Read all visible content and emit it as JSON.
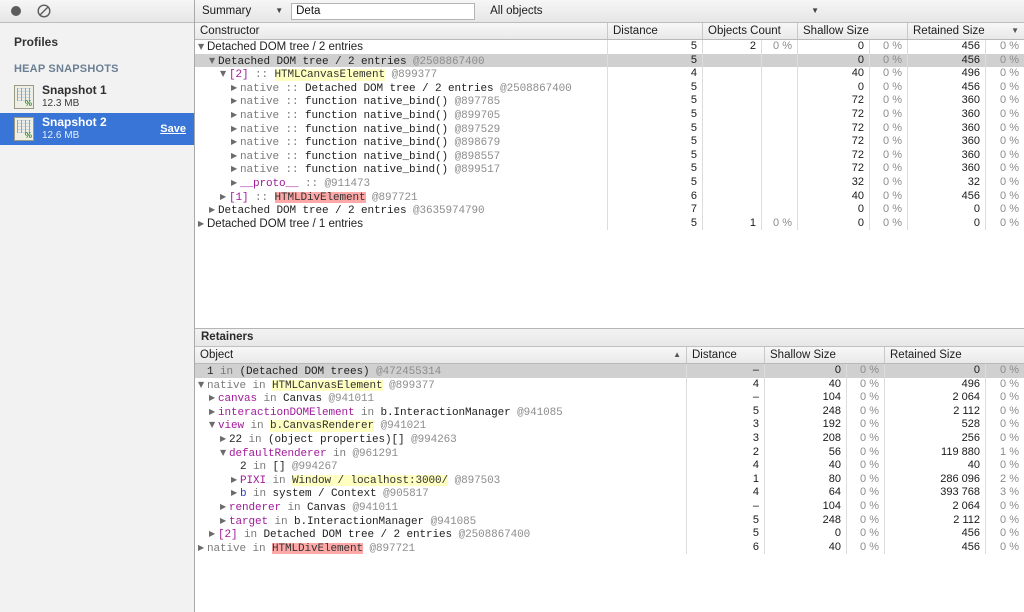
{
  "toolbar": {
    "record_icon": "record-circle-icon",
    "clear_icon": "clear-ban-icon"
  },
  "sidebar": {
    "title": "Profiles",
    "section_label": "HEAP SNAPSHOTS",
    "snapshots": [
      {
        "name": "Snapshot 1",
        "size": "12.3 MB",
        "selected": false,
        "save_label": ""
      },
      {
        "name": "Snapshot 2",
        "size": "12.6 MB",
        "selected": true,
        "save_label": "Save"
      }
    ]
  },
  "main_toolbar": {
    "view_mode": "Summary",
    "search_value": "Deta",
    "filter": "All objects"
  },
  "constructors_grid": {
    "columns": [
      "Constructor",
      "Distance",
      "Objects Count",
      "Shallow Size",
      "Retained Size"
    ],
    "sorted_column": "Retained Size",
    "sort_dir": "desc",
    "rows": [
      {
        "indent": 0,
        "tri": "open",
        "mono": false,
        "parts": [
          {
            "t": "Detached DOM tree / 2 entries",
            "c": "k-plain"
          }
        ],
        "distance": "5",
        "count": "2",
        "count_pct": "0 %",
        "shallow": "0",
        "shallow_pct": "0 %",
        "retained": "456",
        "retained_pct": "0 %",
        "selected": false
      },
      {
        "indent": 1,
        "tri": "open",
        "mono": true,
        "parts": [
          {
            "t": "Detached DOM tree / 2 entries ",
            "c": "k-plain"
          },
          {
            "t": "@2508867400",
            "c": "k-id"
          }
        ],
        "distance": "5",
        "count": "",
        "count_pct": "",
        "shallow": "0",
        "shallow_pct": "0 %",
        "retained": "456",
        "retained_pct": "0 %",
        "selected": true
      },
      {
        "indent": 2,
        "tri": "open",
        "mono": true,
        "parts": [
          {
            "t": "[2]",
            "c": "k-prop"
          },
          {
            "t": " :: ",
            "c": "k-gray"
          },
          {
            "t": "HTMLCanvasElement",
            "c": "hl-y"
          },
          {
            "t": " @899377",
            "c": "k-id"
          }
        ],
        "distance": "4",
        "count": "",
        "count_pct": "",
        "shallow": "40",
        "shallow_pct": "0 %",
        "retained": "496",
        "retained_pct": "0 %",
        "selected": false
      },
      {
        "indent": 3,
        "tri": "closed",
        "mono": true,
        "parts": [
          {
            "t": "native",
            "c": "k-gray"
          },
          {
            "t": " :: ",
            "c": "k-gray"
          },
          {
            "t": "Detached DOM tree / 2 entries ",
            "c": "k-plain"
          },
          {
            "t": "@2508867400",
            "c": "k-id"
          }
        ],
        "distance": "5",
        "count": "",
        "count_pct": "",
        "shallow": "0",
        "shallow_pct": "0 %",
        "retained": "456",
        "retained_pct": "0 %",
        "selected": false
      },
      {
        "indent": 3,
        "tri": "closed",
        "mono": true,
        "parts": [
          {
            "t": "native",
            "c": "k-gray"
          },
          {
            "t": " :: ",
            "c": "k-gray"
          },
          {
            "t": "function native_bind() ",
            "c": "k-plain"
          },
          {
            "t": "@897785",
            "c": "k-id"
          }
        ],
        "distance": "5",
        "count": "",
        "count_pct": "",
        "shallow": "72",
        "shallow_pct": "0 %",
        "retained": "360",
        "retained_pct": "0 %",
        "selected": false
      },
      {
        "indent": 3,
        "tri": "closed",
        "mono": true,
        "parts": [
          {
            "t": "native",
            "c": "k-gray"
          },
          {
            "t": " :: ",
            "c": "k-gray"
          },
          {
            "t": "function native_bind() ",
            "c": "k-plain"
          },
          {
            "t": "@899705",
            "c": "k-id"
          }
        ],
        "distance": "5",
        "count": "",
        "count_pct": "",
        "shallow": "72",
        "shallow_pct": "0 %",
        "retained": "360",
        "retained_pct": "0 %",
        "selected": false
      },
      {
        "indent": 3,
        "tri": "closed",
        "mono": true,
        "parts": [
          {
            "t": "native",
            "c": "k-gray"
          },
          {
            "t": " :: ",
            "c": "k-gray"
          },
          {
            "t": "function native_bind() ",
            "c": "k-plain"
          },
          {
            "t": "@897529",
            "c": "k-id"
          }
        ],
        "distance": "5",
        "count": "",
        "count_pct": "",
        "shallow": "72",
        "shallow_pct": "0 %",
        "retained": "360",
        "retained_pct": "0 %",
        "selected": false
      },
      {
        "indent": 3,
        "tri": "closed",
        "mono": true,
        "parts": [
          {
            "t": "native",
            "c": "k-gray"
          },
          {
            "t": " :: ",
            "c": "k-gray"
          },
          {
            "t": "function native_bind() ",
            "c": "k-plain"
          },
          {
            "t": "@898679",
            "c": "k-id"
          }
        ],
        "distance": "5",
        "count": "",
        "count_pct": "",
        "shallow": "72",
        "shallow_pct": "0 %",
        "retained": "360",
        "retained_pct": "0 %",
        "selected": false
      },
      {
        "indent": 3,
        "tri": "closed",
        "mono": true,
        "parts": [
          {
            "t": "native",
            "c": "k-gray"
          },
          {
            "t": " :: ",
            "c": "k-gray"
          },
          {
            "t": "function native_bind() ",
            "c": "k-plain"
          },
          {
            "t": "@898557",
            "c": "k-id"
          }
        ],
        "distance": "5",
        "count": "",
        "count_pct": "",
        "shallow": "72",
        "shallow_pct": "0 %",
        "retained": "360",
        "retained_pct": "0 %",
        "selected": false
      },
      {
        "indent": 3,
        "tri": "closed",
        "mono": true,
        "parts": [
          {
            "t": "native",
            "c": "k-gray"
          },
          {
            "t": " :: ",
            "c": "k-gray"
          },
          {
            "t": "function native_bind() ",
            "c": "k-plain"
          },
          {
            "t": "@899517",
            "c": "k-id"
          }
        ],
        "distance": "5",
        "count": "",
        "count_pct": "",
        "shallow": "72",
        "shallow_pct": "0 %",
        "retained": "360",
        "retained_pct": "0 %",
        "selected": false
      },
      {
        "indent": 3,
        "tri": "closed",
        "mono": true,
        "parts": [
          {
            "t": "__proto__",
            "c": "k-prop"
          },
          {
            "t": " :: ",
            "c": "k-gray"
          },
          {
            "t": "@911473",
            "c": "k-id"
          }
        ],
        "distance": "5",
        "count": "",
        "count_pct": "",
        "shallow": "32",
        "shallow_pct": "0 %",
        "retained": "32",
        "retained_pct": "0 %",
        "selected": false
      },
      {
        "indent": 2,
        "tri": "closed",
        "mono": true,
        "parts": [
          {
            "t": "[1]",
            "c": "k-prop"
          },
          {
            "t": " :: ",
            "c": "k-gray"
          },
          {
            "t": "HTMLDivElement",
            "c": "hl-r"
          },
          {
            "t": " @897721",
            "c": "k-id"
          }
        ],
        "distance": "6",
        "count": "",
        "count_pct": "",
        "shallow": "40",
        "shallow_pct": "0 %",
        "retained": "456",
        "retained_pct": "0 %",
        "selected": false
      },
      {
        "indent": 1,
        "tri": "closed",
        "mono": true,
        "parts": [
          {
            "t": "Detached DOM tree / 2 entries ",
            "c": "k-plain"
          },
          {
            "t": "@3635974790",
            "c": "k-id"
          }
        ],
        "distance": "7",
        "count": "",
        "count_pct": "",
        "shallow": "0",
        "shallow_pct": "0 %",
        "retained": "0",
        "retained_pct": "0 %",
        "selected": false
      },
      {
        "indent": 0,
        "tri": "closed",
        "mono": false,
        "parts": [
          {
            "t": "Detached DOM tree / 1 entries",
            "c": "k-plain"
          }
        ],
        "distance": "5",
        "count": "1",
        "count_pct": "0 %",
        "shallow": "0",
        "shallow_pct": "0 %",
        "retained": "0",
        "retained_pct": "0 %",
        "selected": false
      }
    ]
  },
  "retainers": {
    "panel_title": "Retainers",
    "columns": [
      "Object",
      "Distance",
      "Shallow Size",
      "Retained Size"
    ],
    "sorted_column": "Object",
    "sort_dir": "asc",
    "rows": [
      {
        "indent": 0,
        "tri": "none",
        "mono": true,
        "parts": [
          {
            "t": "1",
            "c": "k-plain"
          },
          {
            "t": " in ",
            "c": "k-gray"
          },
          {
            "t": "(Detached DOM trees) ",
            "c": "k-plain"
          },
          {
            "t": "@472455314",
            "c": "k-id"
          }
        ],
        "distance": "–",
        "shallow": "0",
        "shallow_pct": "0 %",
        "retained": "0",
        "retained_pct": "0 %",
        "selected": true
      },
      {
        "indent": 0,
        "tri": "open",
        "mono": true,
        "parts": [
          {
            "t": "native",
            "c": "k-gray"
          },
          {
            "t": " in ",
            "c": "k-gray"
          },
          {
            "t": "HTMLCanvasElement",
            "c": "hl-y"
          },
          {
            "t": " @899377",
            "c": "k-id"
          }
        ],
        "distance": "4",
        "shallow": "40",
        "shallow_pct": "0 %",
        "retained": "496",
        "retained_pct": "0 %",
        "selected": false
      },
      {
        "indent": 1,
        "tri": "closed",
        "mono": true,
        "parts": [
          {
            "t": "canvas",
            "c": "k-prop"
          },
          {
            "t": " in ",
            "c": "k-gray"
          },
          {
            "t": "Canvas ",
            "c": "k-plain"
          },
          {
            "t": "@941011",
            "c": "k-id"
          }
        ],
        "distance": "–",
        "shallow": "104",
        "shallow_pct": "0 %",
        "retained": "2 064",
        "retained_pct": "0 %",
        "selected": false
      },
      {
        "indent": 1,
        "tri": "closed",
        "mono": true,
        "parts": [
          {
            "t": "interactionDOMElement",
            "c": "k-prop"
          },
          {
            "t": " in ",
            "c": "k-gray"
          },
          {
            "t": "b.InteractionManager ",
            "c": "k-plain"
          },
          {
            "t": "@941085",
            "c": "k-id"
          }
        ],
        "distance": "5",
        "shallow": "248",
        "shallow_pct": "0 %",
        "retained": "2 112",
        "retained_pct": "0 %",
        "selected": false
      },
      {
        "indent": 1,
        "tri": "open",
        "mono": true,
        "parts": [
          {
            "t": "view",
            "c": "k-prop"
          },
          {
            "t": " in ",
            "c": "k-gray"
          },
          {
            "t": "b.CanvasRenderer",
            "c": "hl-y"
          },
          {
            "t": " @941021",
            "c": "k-id"
          }
        ],
        "distance": "3",
        "shallow": "192",
        "shallow_pct": "0 %",
        "retained": "528",
        "retained_pct": "0 %",
        "selected": false
      },
      {
        "indent": 2,
        "tri": "closed",
        "mono": true,
        "parts": [
          {
            "t": "22",
            "c": "k-plain"
          },
          {
            "t": " in ",
            "c": "k-gray"
          },
          {
            "t": "(object properties)[] ",
            "c": "k-plain"
          },
          {
            "t": "@994263",
            "c": "k-id"
          }
        ],
        "distance": "3",
        "shallow": "208",
        "shallow_pct": "0 %",
        "retained": "256",
        "retained_pct": "0 %",
        "selected": false
      },
      {
        "indent": 2,
        "tri": "open",
        "mono": true,
        "parts": [
          {
            "t": "defaultRenderer",
            "c": "k-prop"
          },
          {
            "t": " in ",
            "c": "k-gray"
          },
          {
            "t": "@961291",
            "c": "k-id"
          }
        ],
        "distance": "2",
        "shallow": "56",
        "shallow_pct": "0 %",
        "retained": "119 880",
        "retained_pct": "1 %",
        "selected": false
      },
      {
        "indent": 3,
        "tri": "none",
        "mono": true,
        "parts": [
          {
            "t": "2",
            "c": "k-plain"
          },
          {
            "t": " in ",
            "c": "k-gray"
          },
          {
            "t": "[] ",
            "c": "k-plain"
          },
          {
            "t": "@994267",
            "c": "k-id"
          }
        ],
        "distance": "4",
        "shallow": "40",
        "shallow_pct": "0 %",
        "retained": "40",
        "retained_pct": "0 %",
        "selected": false
      },
      {
        "indent": 3,
        "tri": "closed",
        "mono": true,
        "parts": [
          {
            "t": "PIXI",
            "c": "k-prop"
          },
          {
            "t": " in ",
            "c": "k-gray"
          },
          {
            "t": "Window / localhost:3000/",
            "c": "hl-y"
          },
          {
            "t": " @897503",
            "c": "k-id"
          }
        ],
        "distance": "1",
        "shallow": "80",
        "shallow_pct": "0 %",
        "retained": "286 096",
        "retained_pct": "2 %",
        "selected": false
      },
      {
        "indent": 3,
        "tri": "closed",
        "mono": true,
        "parts": [
          {
            "t": "b",
            "c": "k-blue"
          },
          {
            "t": " in ",
            "c": "k-gray"
          },
          {
            "t": "system / Context ",
            "c": "k-plain"
          },
          {
            "t": "@905817",
            "c": "k-id"
          }
        ],
        "distance": "4",
        "shallow": "64",
        "shallow_pct": "0 %",
        "retained": "393 768",
        "retained_pct": "3 %",
        "selected": false
      },
      {
        "indent": 2,
        "tri": "closed",
        "mono": true,
        "parts": [
          {
            "t": "renderer",
            "c": "k-prop"
          },
          {
            "t": " in ",
            "c": "k-gray"
          },
          {
            "t": "Canvas ",
            "c": "k-plain"
          },
          {
            "t": "@941011",
            "c": "k-id"
          }
        ],
        "distance": "–",
        "shallow": "104",
        "shallow_pct": "0 %",
        "retained": "2 064",
        "retained_pct": "0 %",
        "selected": false
      },
      {
        "indent": 2,
        "tri": "closed",
        "mono": true,
        "parts": [
          {
            "t": "target",
            "c": "k-prop"
          },
          {
            "t": " in ",
            "c": "k-gray"
          },
          {
            "t": "b.InteractionManager ",
            "c": "k-plain"
          },
          {
            "t": "@941085",
            "c": "k-id"
          }
        ],
        "distance": "5",
        "shallow": "248",
        "shallow_pct": "0 %",
        "retained": "2 112",
        "retained_pct": "0 %",
        "selected": false
      },
      {
        "indent": 1,
        "tri": "closed",
        "mono": true,
        "parts": [
          {
            "t": "[2]",
            "c": "k-prop"
          },
          {
            "t": " in ",
            "c": "k-gray"
          },
          {
            "t": "Detached DOM tree / 2 entries ",
            "c": "k-plain"
          },
          {
            "t": "@2508867400",
            "c": "k-id"
          }
        ],
        "distance": "5",
        "shallow": "0",
        "shallow_pct": "0 %",
        "retained": "456",
        "retained_pct": "0 %",
        "selected": false
      },
      {
        "indent": 0,
        "tri": "closed",
        "mono": true,
        "parts": [
          {
            "t": "native",
            "c": "k-gray"
          },
          {
            "t": " in ",
            "c": "k-gray"
          },
          {
            "t": "HTMLDivElement",
            "c": "hl-r"
          },
          {
            "t": " @897721",
            "c": "k-id"
          }
        ],
        "distance": "6",
        "shallow": "40",
        "shallow_pct": "0 %",
        "retained": "456",
        "retained_pct": "0 %",
        "selected": false
      }
    ]
  },
  "colors": {
    "selection_blue": "#3875d7",
    "row_selected_gray": "#d0d0d0",
    "highlight_yellow": "#ffffc2",
    "highlight_red": "#ffa8a8",
    "property_purple": "#a11b9a"
  }
}
